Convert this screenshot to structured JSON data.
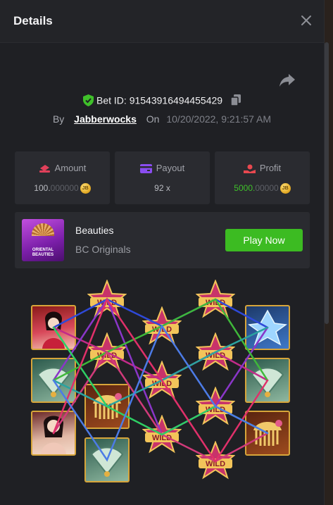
{
  "modal": {
    "title": "Details"
  },
  "bet": {
    "label": "Bet ID:",
    "id": "91543916494455429",
    "by_label": "By",
    "user": "Jabberwocks",
    "on_label": "On",
    "datetime": "10/20/2022, 9:21:57 AM"
  },
  "stats": {
    "amount": {
      "label": "Amount",
      "value_main": "100.",
      "value_dim": "000000",
      "coin": "JB"
    },
    "payout": {
      "label": "Payout",
      "value": "92 x"
    },
    "profit": {
      "label": "Profit",
      "value_main": "5000.",
      "value_dim": "00000",
      "coin": "JB"
    }
  },
  "game": {
    "thumb_text": "ORIENTAL BEAUTIES",
    "name": "Beauties",
    "provider": "BC Originals",
    "play_label": "Play Now"
  },
  "board": {
    "wild_text": "WILD",
    "symbols": [
      "beauty-red",
      "fan-teal",
      "beauty-pink",
      "comb-gold",
      "fan-teal",
      "crystal-blue",
      "fan-teal",
      "comb-gold"
    ]
  },
  "colors": {
    "accent_green": "#3cbb22",
    "profit_green": "#3fc02a",
    "amount_icon": "#e0405a",
    "payout_icon": "#8a4df0",
    "profit_icon": "#e8484f"
  }
}
